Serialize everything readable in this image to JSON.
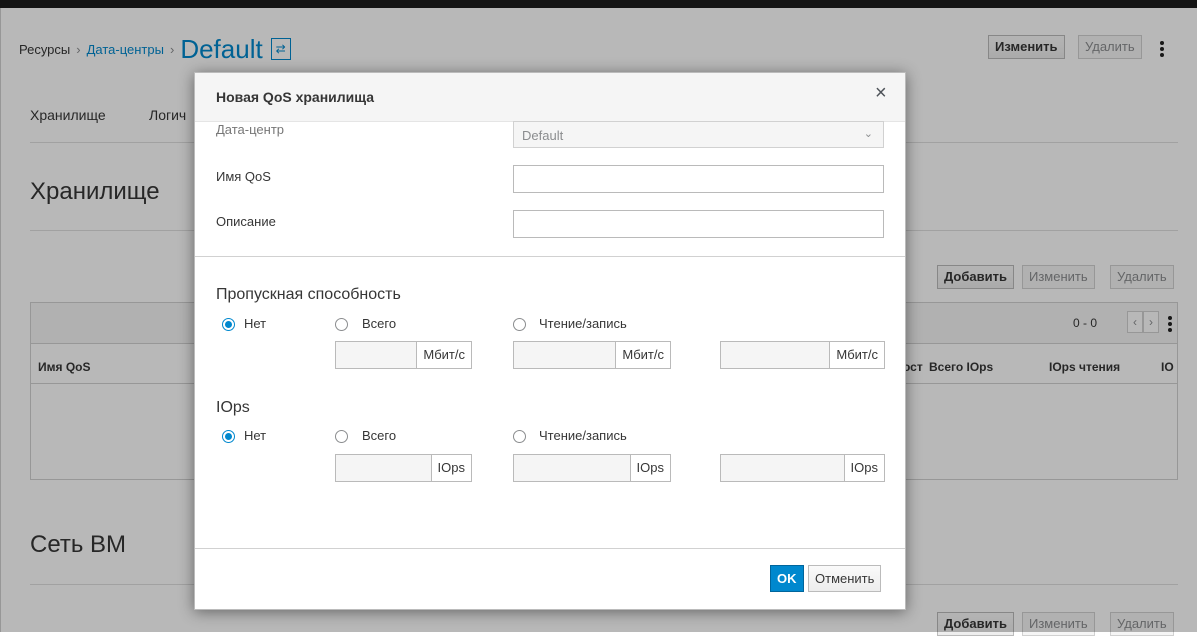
{
  "breadcrumb": {
    "resources": "Ресурсы",
    "sep1": "›",
    "datacenters": "Дата-центры",
    "sep2": "›",
    "current": "Default"
  },
  "switch_icon": "⇄",
  "header_actions": {
    "edit": "Изменить",
    "delete": "Удалить"
  },
  "tabs": {
    "storage": "Хранилище",
    "logical": "Логич"
  },
  "section_storage": {
    "title": "Хранилище",
    "add": "Добавить",
    "edit": "Изменить",
    "delete": "Удалить",
    "pagination": "0 - 0",
    "columns": [
      "Имя QoS",
      "ост",
      "Всего IOps",
      "IOps чтения",
      "IO"
    ]
  },
  "section_net": {
    "title": "Сеть ВМ",
    "add": "Добавить",
    "edit": "Изменить",
    "delete": "Удалить"
  },
  "modal": {
    "title": "Новая QoS хранилища",
    "close": "×",
    "datacenter_label": "Дата-центр",
    "datacenter_value": "Default",
    "name_label": "Имя QoS",
    "name_value": "",
    "desc_label": "Описание",
    "desc_value": "",
    "throughput": {
      "heading": "Пропускная способность",
      "opt_none": "Нет",
      "opt_total": "Всего",
      "opt_rw": "Чтение/запись",
      "selected": "none",
      "unit": "Мбит/с"
    },
    "iops": {
      "heading": "IOps",
      "opt_none": "Нет",
      "opt_total": "Всего",
      "opt_rw": "Чтение/запись",
      "selected": "none",
      "unit": "IOps"
    },
    "ok": "OK",
    "cancel": "Отменить"
  }
}
